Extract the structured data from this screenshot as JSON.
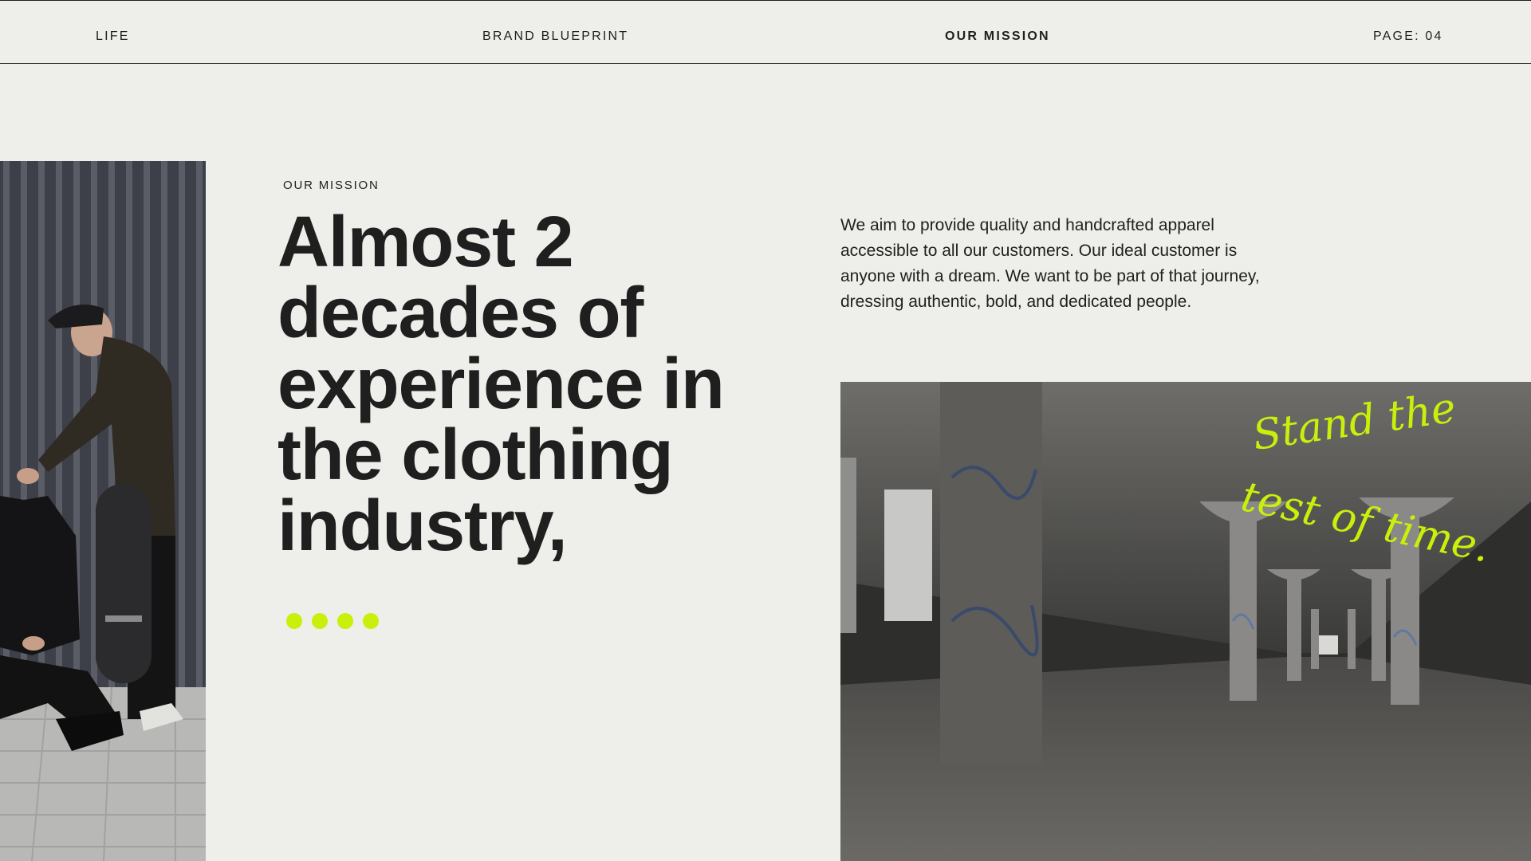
{
  "header": {
    "left": "LIFE",
    "brand": "BRAND BLUEPRINT",
    "section": "OUR MISSION",
    "page": "PAGE: 04"
  },
  "main": {
    "eyebrow": "OUR MISSION",
    "headline": "Almost 2 decades of experience in the clothing industry,",
    "paragraph": "We aim to provide quality and handcrafted apparel accessible to all our customers. Our ideal customer is anyone with a dream. We want to be part of that journey, dressing authentic, bold, and dedicated people.",
    "dots_count": 4,
    "accent_color": "#c8f00a"
  },
  "images": {
    "left": "photo-two-men-skateboard",
    "right": "photo-abandoned-warehouse-graffiti-columns",
    "overlay_script": "Stand the test of time."
  }
}
